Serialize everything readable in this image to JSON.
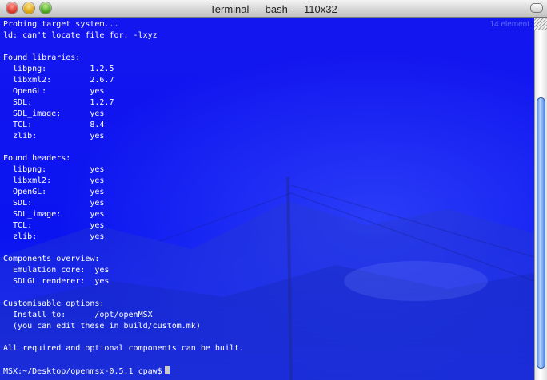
{
  "window": {
    "title": "Terminal — bash — 110x32"
  },
  "desktop_overlay": {
    "line1": "14 element",
    "line2": ""
  },
  "terminal": {
    "lines": [
      "Probing target system...",
      "ld: can't locate file for: -lxyz",
      "",
      "Found libraries:",
      "  libpng:         1.2.5",
      "  libxml2:        2.6.7",
      "  OpenGL:         yes",
      "  SDL:            1.2.7",
      "  SDL_image:      yes",
      "  TCL:            8.4",
      "  zlib:           yes",
      "",
      "Found headers:",
      "  libpng:         yes",
      "  libxml2:        yes",
      "  OpenGL:         yes",
      "  SDL:            yes",
      "  SDL_image:      yes",
      "  TCL:            yes",
      "  zlib:           yes",
      "",
      "Components overview:",
      "  Emulation core:  yes",
      "  SDLGL renderer:  yes",
      "",
      "Customisable options:",
      "  Install to:      /opt/openMSX",
      "  (you can edit these in build/custom.mk)",
      "",
      "All required and optional components can be built.",
      "",
      "MSX:~/Desktop/openmsx-0.5.1 cpaw$"
    ]
  },
  "colors": {
    "terminal_bg": "#0a14f0",
    "text": "#ffffff",
    "scroll_thumb": "#5a8ee6"
  }
}
